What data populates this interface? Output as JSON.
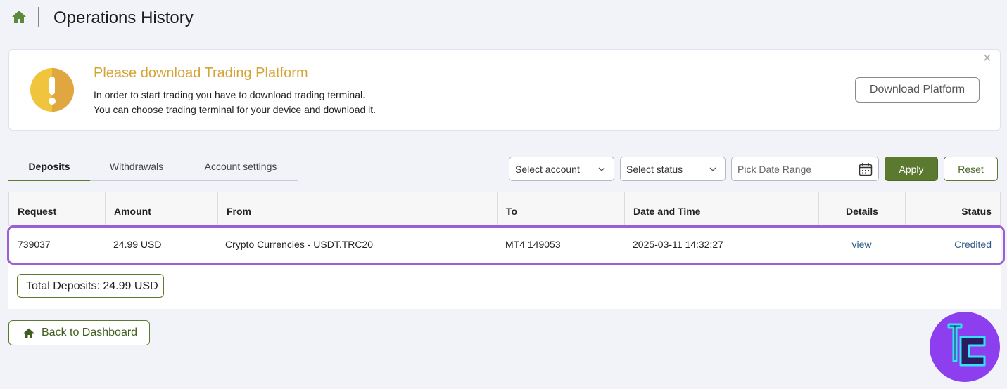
{
  "header": {
    "title": "Operations History"
  },
  "banner": {
    "title": "Please download Trading Platform",
    "line1": "In order to start trading you have to download trading terminal.",
    "line2": "You can choose trading terminal for your device and download it.",
    "download_label": "Download Platform",
    "close_glyph": "×"
  },
  "tabs": [
    {
      "label": "Deposits",
      "active": true
    },
    {
      "label": "Withdrawals",
      "active": false
    },
    {
      "label": "Account settings",
      "active": false
    }
  ],
  "filters": {
    "account_value": "Select account",
    "status_value": "Select status",
    "date_placeholder": "Pick Date Range",
    "apply_label": "Apply",
    "reset_label": "Reset"
  },
  "table": {
    "columns": [
      "Request",
      "Amount",
      "From",
      "To",
      "Date and Time",
      "Details",
      "Status"
    ],
    "rows": [
      {
        "request": "739037",
        "amount": "24.99 USD",
        "from": "Crypto Currencies - USDT.TRC20",
        "to": "MT4 149053",
        "datetime": "2025-03-11 14:32:27",
        "details": "view",
        "status": "Credited"
      }
    ]
  },
  "total": {
    "label": "Total Deposits: 24.99 USD"
  },
  "back_button": {
    "label": "Back to Dashboard"
  },
  "colors": {
    "accent_green": "#5b7a2f",
    "warning_yellow": "#d5a437",
    "highlight_purple": "#9b5fd4",
    "link_blue": "#2d5a8a"
  },
  "icons": {
    "home": "home-icon",
    "warning": "exclamation-icon",
    "calendar": "calendar-icon",
    "chevron": "chevron-down-icon",
    "logo": "tc-logo-icon"
  }
}
